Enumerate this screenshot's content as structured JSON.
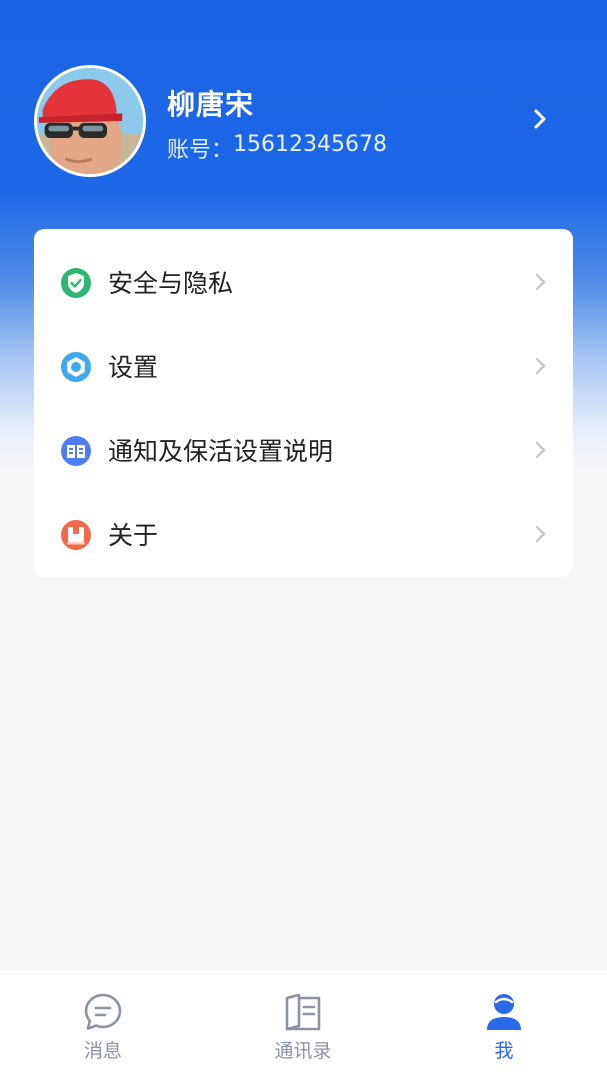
{
  "profile": {
    "name": "柳唐宋",
    "account_label": "账号：",
    "account_number": "15612345678",
    "avatar_icon": "user-photo",
    "chevron_icon": "chevron-right-icon"
  },
  "menu": {
    "items": [
      {
        "label": "安全与隐私",
        "icon": "shield-check-icon",
        "color": "#2bb673"
      },
      {
        "label": "设置",
        "icon": "settings-ring-icon",
        "color": "#3fa8f0"
      },
      {
        "label": "通知及保活设置说明",
        "icon": "book-icon",
        "color": "#4f7ef2"
      },
      {
        "label": "关于",
        "icon": "about-card-icon",
        "color": "#f06a4a"
      }
    ]
  },
  "tabbar": {
    "tabs": [
      {
        "label": "消息",
        "icon": "chat-bubble-icon",
        "active": false
      },
      {
        "label": "通讯录",
        "icon": "contacts-book-icon",
        "active": false
      },
      {
        "label": "我",
        "icon": "person-icon",
        "active": true
      }
    ]
  },
  "colors": {
    "brand_blue": "#1a63e3",
    "active_tab": "#2b6ae6",
    "inactive_tab": "#8a93a3"
  }
}
